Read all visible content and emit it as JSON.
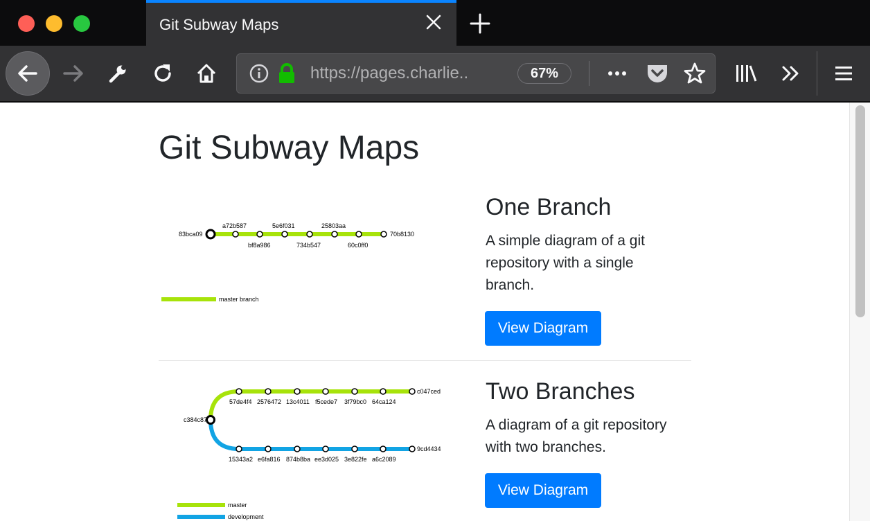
{
  "window": {
    "tab_title": "Git Subway Maps",
    "icons": [
      "close-icon",
      "plus-icon"
    ]
  },
  "toolbar": {
    "url": "https://pages.charlie...",
    "zoom": "67%",
    "icons": [
      "back-arrow-icon",
      "forward-arrow-icon",
      "wrench-icon",
      "reload-icon",
      "home-icon",
      "info-icon",
      "lock-icon",
      "more-icon",
      "pocket-icon",
      "star-icon",
      "library-icon",
      "overflow-chevron-icon",
      "menu-icon"
    ]
  },
  "colors": {
    "accent_blue": "#0a84ff",
    "button_blue": "#007bff",
    "master_green": "#a7e30a",
    "development_blue": "#12a4e4",
    "lock_green": "#12bc00"
  },
  "page": {
    "heading": "Git Subway Maps",
    "cards": [
      {
        "title": "One Branch",
        "description": "A simple diagram of a git repository with a single branch.",
        "button": "View Diagram",
        "diagram": {
          "start_commit": "83bca09",
          "top_labels": [
            "a72b587",
            "5e6f031",
            "25803aa"
          ],
          "bottom_labels": [
            "bf8a986",
            "734b547",
            "60c0ff0"
          ],
          "end_commit": "70b8130",
          "legend": [
            "master branch"
          ]
        }
      },
      {
        "title": "Two Branches",
        "description": "A diagram of a git repository with two branches.",
        "button": "View Diagram",
        "diagram": {
          "root_commit": "c384c87",
          "master_commits": [
            "57de4f4",
            "2576472",
            "13c4011",
            "f5cede7",
            "3f79bc0",
            "64ca124"
          ],
          "master_head": "c047ced",
          "development_commits": [
            "15343a2",
            "e6fa816",
            "874b8ba",
            "ee3d025",
            "3e822fe",
            "a6c2089"
          ],
          "development_head": "9cd4434",
          "legend": [
            "master",
            "development"
          ]
        }
      }
    ]
  }
}
